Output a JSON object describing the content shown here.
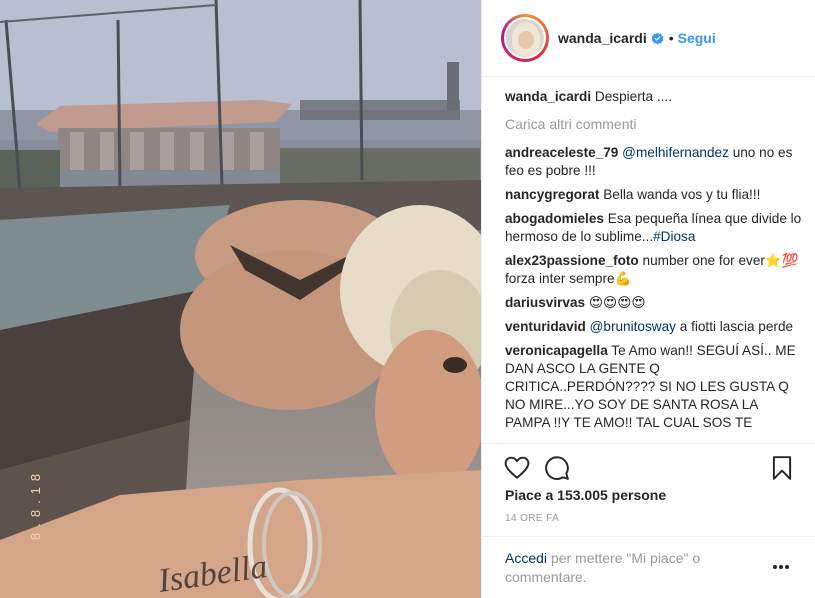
{
  "post": {
    "username": "wanda_icardi",
    "separator": "•",
    "follow_label": "Segui",
    "caption": {
      "user": "wanda_icardi",
      "text": "Despierta ...."
    },
    "load_more_label": "Carica altri commenti",
    "comments": [
      {
        "user": "andreaceleste_79",
        "mention": "@melhifernandez",
        "text": "uno no es feo es pobre !!!"
      },
      {
        "user": "nancygregorat",
        "mention": "",
        "text": "Bella wanda vos y tu flia!!!"
      },
      {
        "user": "abogadomieles",
        "pre": "Esa pequeña línea que divide lo hermoso de lo sublime...",
        "mention": "#Diosa",
        "text": ""
      },
      {
        "user": "alex23passione_foto",
        "mention": "",
        "text": "number one for ever⭐💯 forza inter sempre💪"
      },
      {
        "user": "dariusvirvas",
        "mention": "",
        "text": "😍😍😍😍"
      },
      {
        "user": "venturidavid",
        "mention": "@brunitosway",
        "text": "a fiotti lascia perde"
      },
      {
        "user": "veronicapagella",
        "mention": "",
        "text": "Te Amo wan!! SEGUÍ ASÍ.. ME DAN ASCO LA GENTE Q CRITICA..PERDÓN???? SI NO LES GUSTA Q NO MIRE...YO SOY DE SANTA ROSA LA PAMPA !!Y TE AMO!! TAL CUAL SOS TE"
      }
    ],
    "likes_prefix": "Piace a",
    "likes_count": "153.005 persone",
    "time_ago": "14 ORE FA",
    "login_link": "Accedi",
    "login_text": " per mettere \"Mi piace\" o commentare.",
    "photo_stamp": "8.8.18",
    "photo_tattoo": "Isabella"
  },
  "colors": {
    "accent": "#3897f0",
    "link": "#003569",
    "muted": "#999999",
    "text": "#262626"
  },
  "icons": [
    "verified-badge-icon",
    "heart-icon",
    "comment-icon",
    "bookmark-icon",
    "more-options-icon"
  ]
}
